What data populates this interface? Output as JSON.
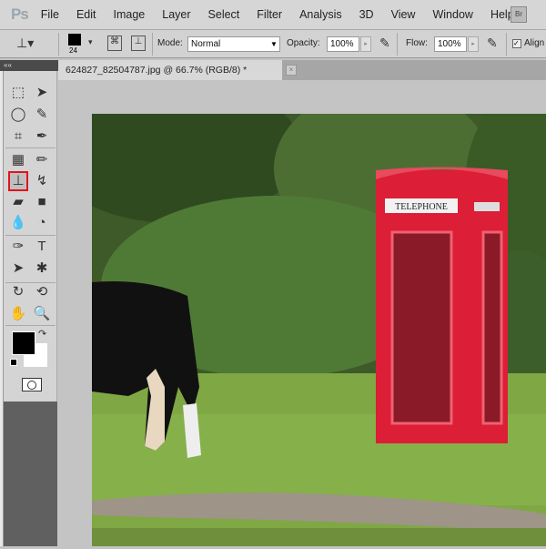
{
  "app": {
    "logo": "Ps",
    "bridge": "Br"
  },
  "menu": [
    "File",
    "Edit",
    "Image",
    "Layer",
    "Select",
    "Filter",
    "Analysis",
    "3D",
    "View",
    "Window",
    "Help"
  ],
  "options": {
    "brush_size": "24",
    "mode_label": "Mode:",
    "mode_value": "Normal",
    "opacity_label": "Opacity:",
    "opacity_value": "100%",
    "flow_label": "Flow:",
    "flow_value": "100%",
    "aligned_label": "Align"
  },
  "document": {
    "tab_title": "624827_82504787.jpg @ 66.7% (RGB/8) *",
    "close": "×"
  },
  "tools_panel": {
    "collapse": "««"
  },
  "tools": [
    {
      "name": "marquee",
      "glyph": "⬚"
    },
    {
      "name": "move",
      "glyph": "➤"
    },
    {
      "name": "lasso",
      "glyph": "◯"
    },
    {
      "name": "quick-selection",
      "glyph": "✎"
    },
    {
      "name": "crop",
      "glyph": "⌗"
    },
    {
      "name": "eyedropper",
      "glyph": "✒"
    },
    {
      "name": "spot-healing",
      "glyph": "▦"
    },
    {
      "name": "brush",
      "glyph": "✏"
    },
    {
      "name": "clone-stamp",
      "glyph": "⊥"
    },
    {
      "name": "history-brush",
      "glyph": "↯"
    },
    {
      "name": "eraser",
      "glyph": "▰"
    },
    {
      "name": "gradient",
      "glyph": "■"
    },
    {
      "name": "blur",
      "glyph": "💧"
    },
    {
      "name": "dodge",
      "glyph": "◔"
    },
    {
      "name": "pen",
      "glyph": "✑"
    },
    {
      "name": "type",
      "glyph": "T"
    },
    {
      "name": "path-selection",
      "glyph": "➤"
    },
    {
      "name": "custom-shape",
      "glyph": "✱"
    },
    {
      "name": "3d-rotate",
      "glyph": "↻"
    },
    {
      "name": "3d-orbit",
      "glyph": "⟲"
    },
    {
      "name": "hand",
      "glyph": "✋"
    },
    {
      "name": "zoom",
      "glyph": "🔍"
    }
  ],
  "selected_tool": "clone-stamp",
  "colors": {
    "foreground": "#000000",
    "background": "#ffffff",
    "highlight": "#e0141e",
    "phone_box": "#e0203a"
  },
  "photo": {
    "sign_text": "TELEPHONE"
  }
}
